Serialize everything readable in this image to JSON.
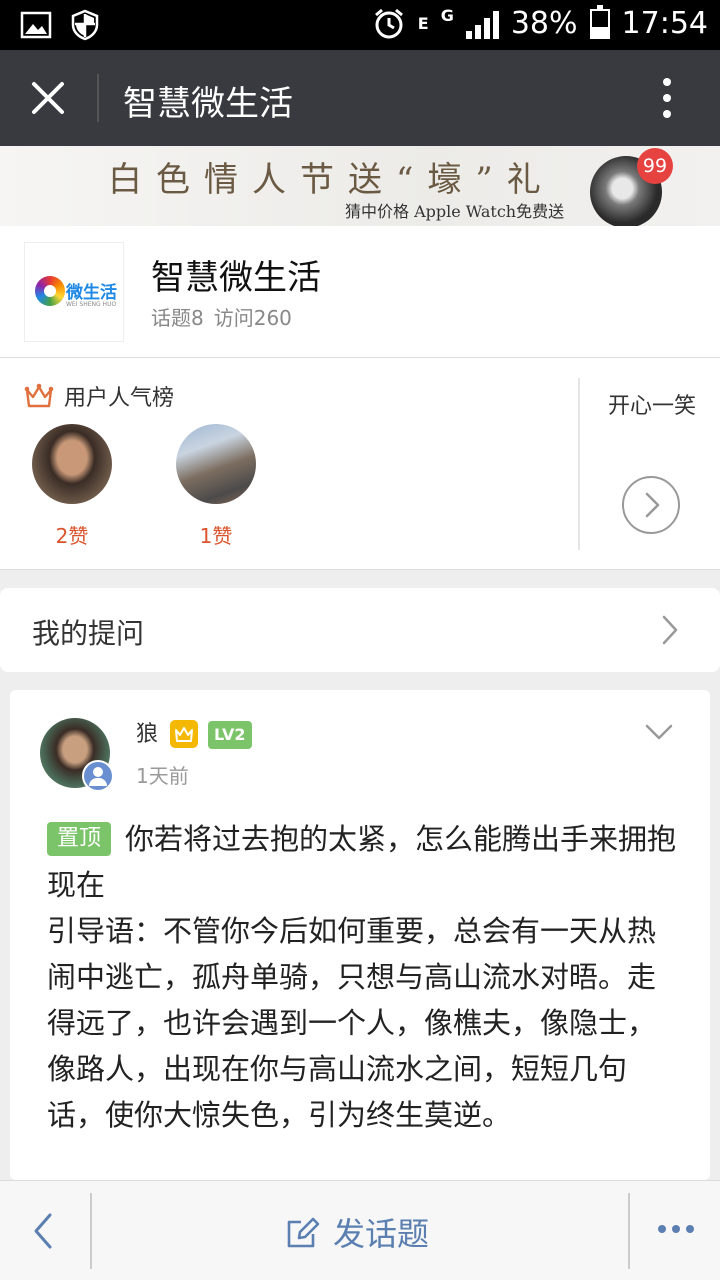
{
  "status_bar": {
    "battery": "38%",
    "time": "17:54",
    "network": "E",
    "network2": "G"
  },
  "header": {
    "title": "智慧微生活"
  },
  "banner": {
    "title": "白色情人节送“壕”礼",
    "subtitle": "猜中价格 Apple Watch免费送",
    "badge": "99"
  },
  "community": {
    "logo_text": "微生活",
    "logo_sub": "WEI SHENG HUO",
    "name": "智慧微生活",
    "topics": "话题8",
    "visits": "访问260"
  },
  "popularity": {
    "heading": "用户人气榜",
    "users": [
      {
        "likes": "2赞"
      },
      {
        "likes": "1赞"
      }
    ],
    "side_label": "开心一笑"
  },
  "my_questions": {
    "label": "我的提问"
  },
  "post": {
    "username": "狼",
    "level": "LV2",
    "time": "1天前",
    "pin_label": "置顶",
    "title": "你若将过去抱的太紧，怎么能腾出手来拥抱现在",
    "body": "引导语：不管你今后如何重要，总会有一天从热闹中逃亡，孤舟单骑，只想与高山流水对晤。走得远了，也许会遇到一个人，像樵夫，像隐士，像路人，出现在你与高山流水之间，短短几句话，使你大惊失色，引为终生莫逆。"
  },
  "bottom_bar": {
    "post_label": "发话题"
  },
  "colors": {
    "title_bar": "#393a3f",
    "accent_green": "#7cc46a",
    "likes_red": "#d9542c",
    "link_blue": "#5a7fb0"
  }
}
